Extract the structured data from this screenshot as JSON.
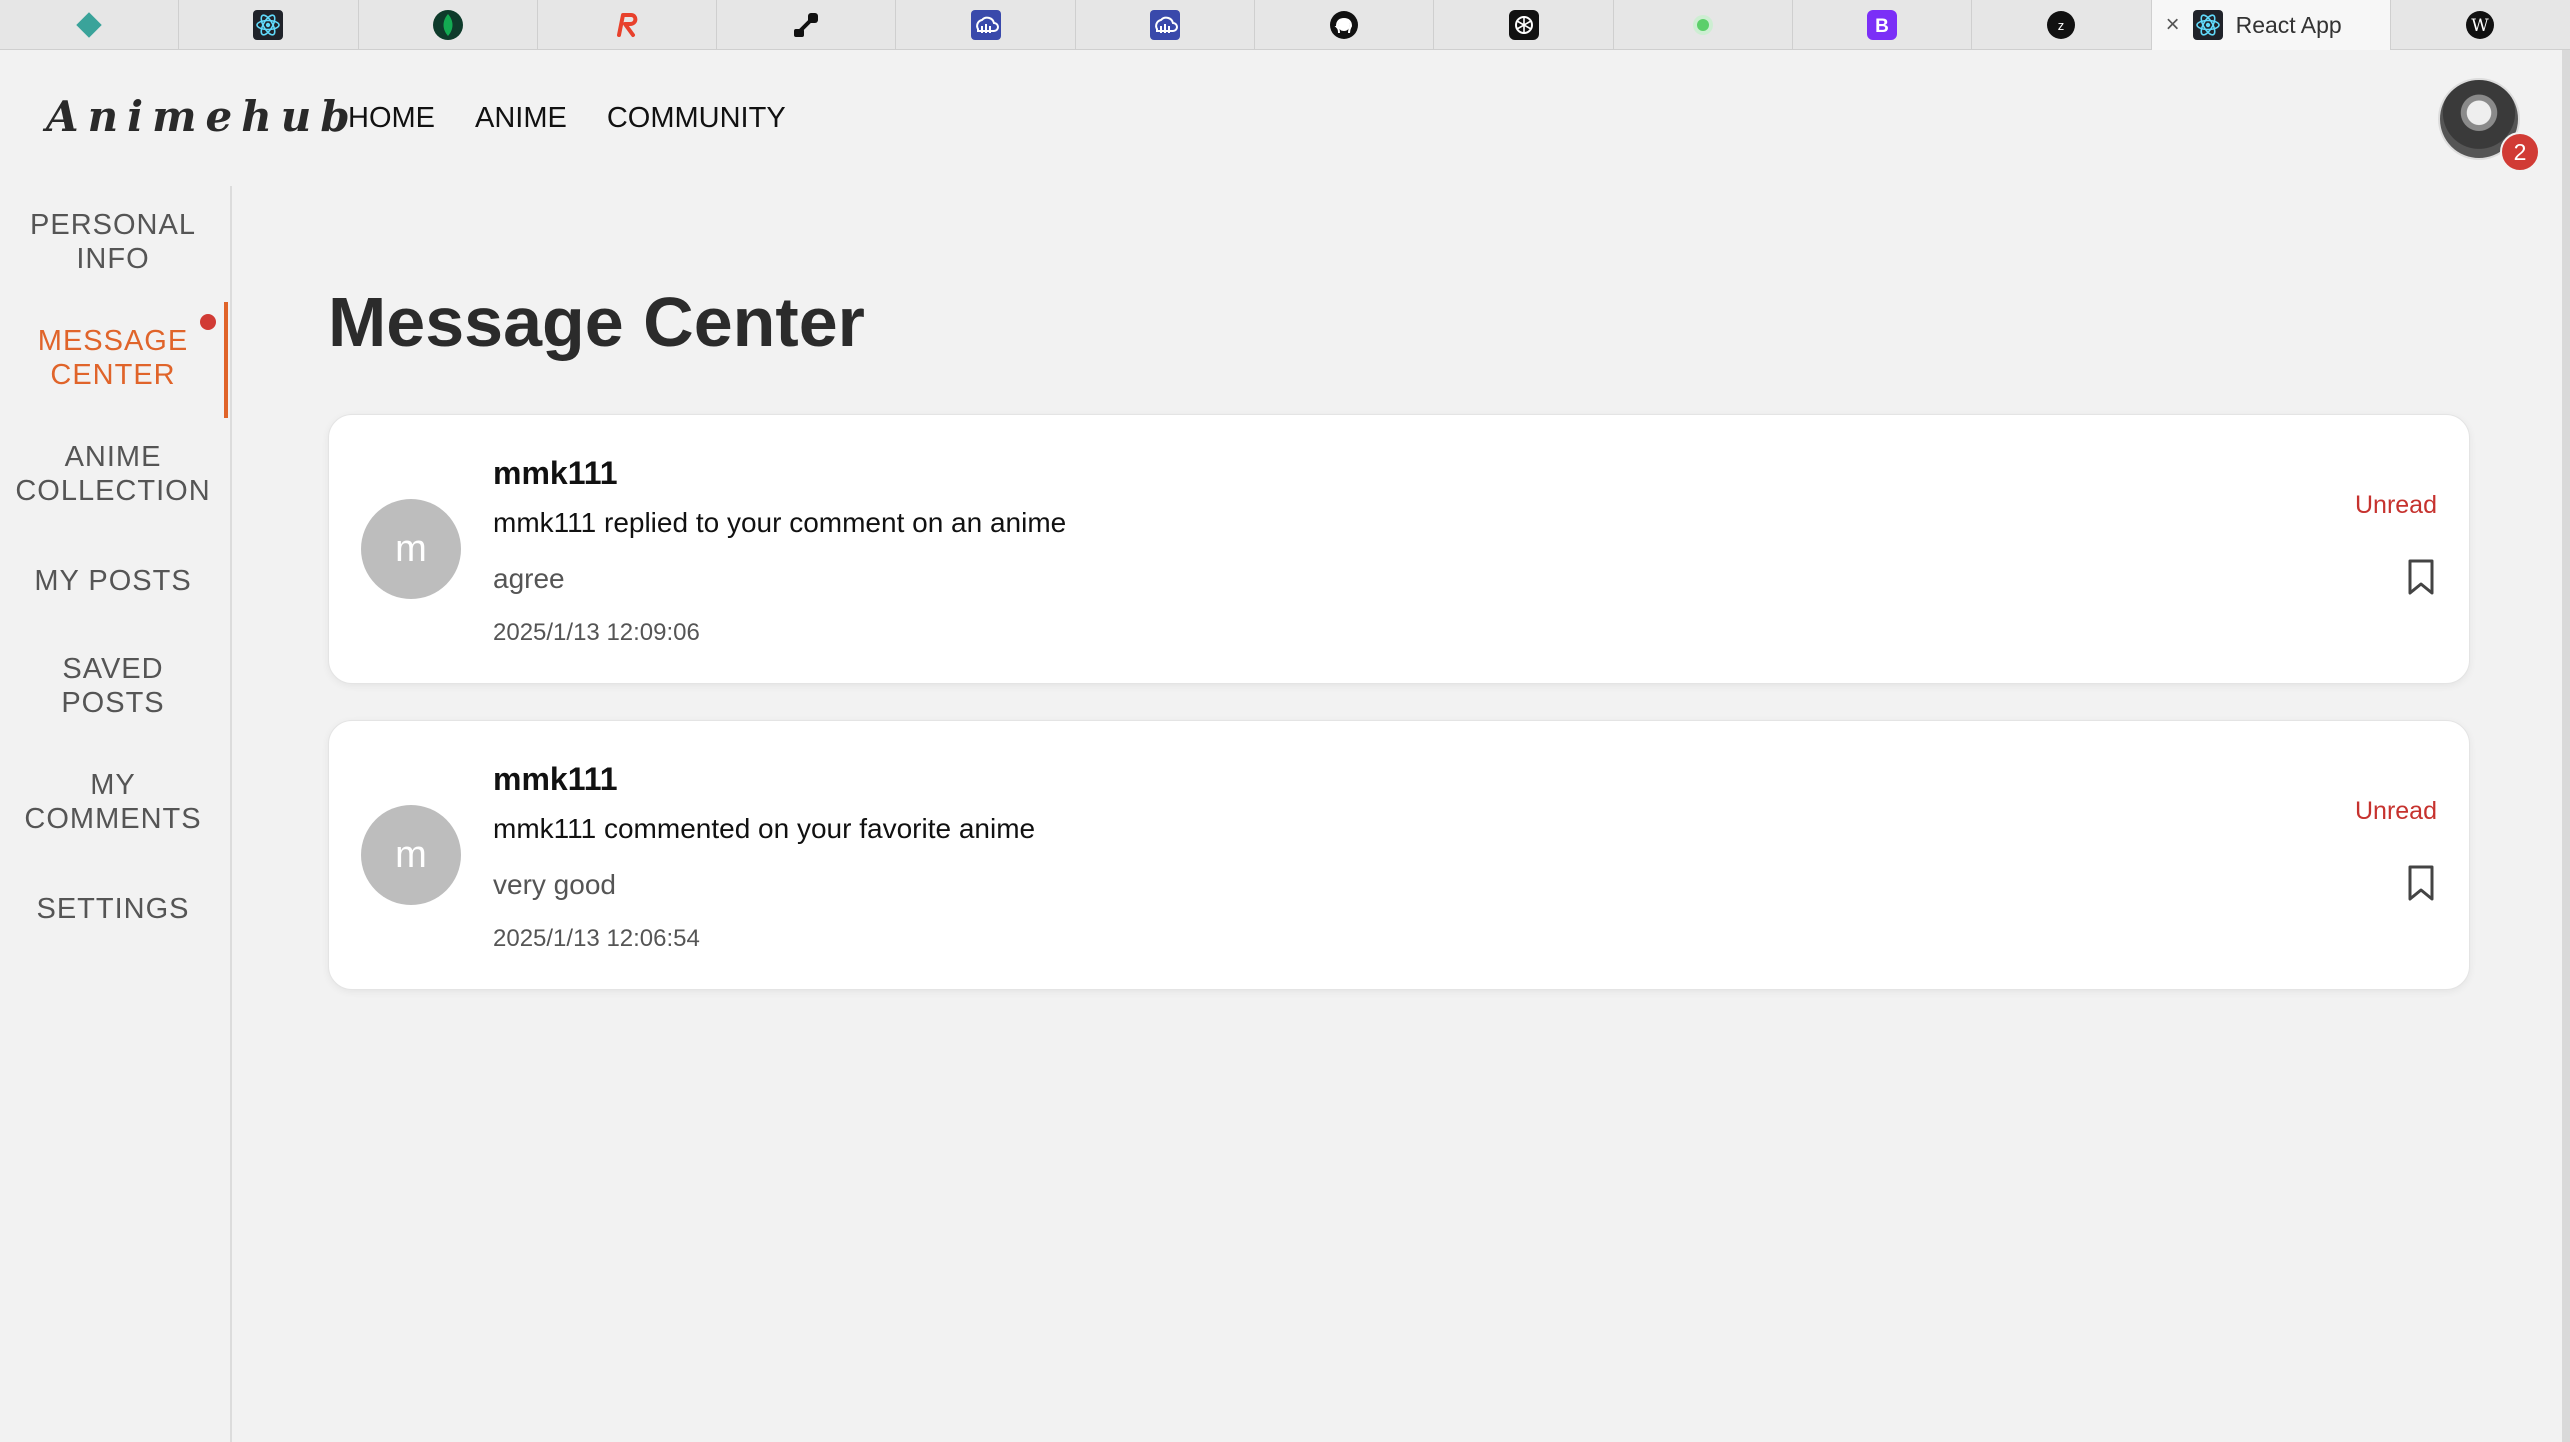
{
  "browser": {
    "tabs": [
      {
        "icon": "diamond-favicon",
        "color": "#3aa39a"
      },
      {
        "icon": "react-favicon",
        "color": "#61dafb"
      },
      {
        "icon": "mongodb-leaf-favicon",
        "color": "#13aa52"
      },
      {
        "icon": "r-logo-favicon",
        "color": "#e8412c"
      },
      {
        "icon": "brush-favicon",
        "color": "#111111"
      },
      {
        "icon": "cloud-favicon",
        "color": "#3949ab"
      },
      {
        "icon": "cloud-favicon",
        "color": "#3949ab"
      },
      {
        "icon": "github-favicon",
        "color": "#111111"
      },
      {
        "icon": "openai-favicon",
        "color": "#111111"
      },
      {
        "icon": "green-dot-favicon",
        "color": "#5ccf6a"
      },
      {
        "icon": "bootstrap-favicon",
        "color": "#7b2ff7"
      },
      {
        "icon": "z-favicon",
        "color": "#111111"
      }
    ],
    "active_tab": {
      "title": "React App",
      "close_icon": "×"
    },
    "last_tab": {
      "icon": "wikipedia-favicon",
      "letter": "W"
    }
  },
  "header": {
    "logo": "Animehub",
    "nav": [
      "HOME",
      "ANIME",
      "COMMUNITY"
    ],
    "avatar_badge": "2"
  },
  "sidebar": {
    "items": [
      {
        "label_1": "PERSONAL",
        "label_2": "INFO"
      },
      {
        "label_1": "MESSAGE",
        "label_2": "CENTER"
      },
      {
        "label_1": "ANIME",
        "label_2": "COLLECTION"
      },
      {
        "label_1": "MY POSTS",
        "label_2": ""
      },
      {
        "label_1": "SAVED",
        "label_2": "POSTS"
      },
      {
        "label_1": "MY",
        "label_2": "COMMENTS"
      },
      {
        "label_1": "SETTINGS",
        "label_2": ""
      }
    ],
    "active_index": 1
  },
  "main": {
    "title": "Message Center",
    "messages": [
      {
        "avatar_letter": "m",
        "user": "mmk111",
        "action": "mmk111 replied to your comment on an anime",
        "content": "agree",
        "time": "2025/1/13 12:09:06",
        "status": "Unread"
      },
      {
        "avatar_letter": "m",
        "user": "mmk111",
        "action": "mmk111 commented on your favorite anime",
        "content": "very good",
        "time": "2025/1/13 12:06:54",
        "status": "Unread"
      }
    ]
  },
  "colors": {
    "accent": "#e0642a",
    "badge": "#d13b35",
    "unread": "#c6322e"
  }
}
